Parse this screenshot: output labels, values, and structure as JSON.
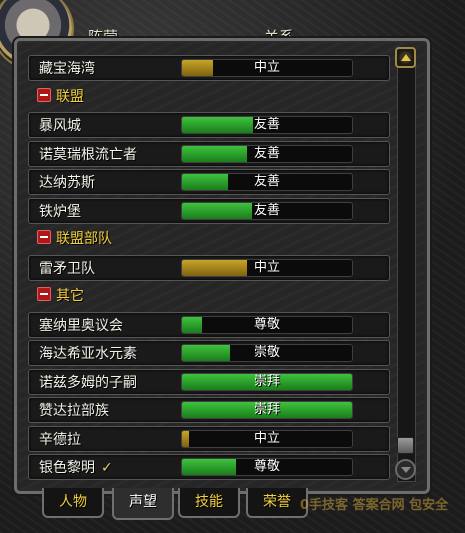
{
  "columns": {
    "faction": "阵营",
    "standing": "关系"
  },
  "rows": [
    {
      "type": "faction",
      "name": "藏宝海湾",
      "standing": "中立",
      "progress": 0.18,
      "color": "#c9a428"
    },
    {
      "type": "header",
      "name": "联盟"
    },
    {
      "type": "faction",
      "name": "暴风城",
      "standing": "友善",
      "progress": 0.42,
      "color": "#2ea82e"
    },
    {
      "type": "faction",
      "name": "诺莫瑞根流亡者",
      "standing": "友善",
      "progress": 0.38,
      "color": "#2ea82e"
    },
    {
      "type": "faction",
      "name": "达纳苏斯",
      "standing": "友善",
      "progress": 0.27,
      "color": "#2ea82e"
    },
    {
      "type": "faction",
      "name": "铁炉堡",
      "standing": "友善",
      "progress": 0.41,
      "color": "#2ea82e"
    },
    {
      "type": "header",
      "name": "联盟部队"
    },
    {
      "type": "faction",
      "name": "雷矛卫队",
      "standing": "中立",
      "progress": 0.38,
      "color": "#c9a428"
    },
    {
      "type": "header",
      "name": "其它"
    },
    {
      "type": "faction",
      "name": "塞纳里奥议会",
      "standing": "尊敬",
      "progress": 0.12,
      "color": "#2ea82e"
    },
    {
      "type": "faction",
      "name": "海达希亚水元素",
      "standing": "崇敬",
      "progress": 0.28,
      "color": "#2ea82e"
    },
    {
      "type": "faction",
      "name": "诺兹多姆的子嗣",
      "standing": "崇拜",
      "progress": 1.0,
      "color": "#2ea82e"
    },
    {
      "type": "faction",
      "name": "赞达拉部族",
      "standing": "崇拜",
      "progress": 1.0,
      "color": "#2ea82e"
    },
    {
      "type": "faction",
      "name": "辛德拉",
      "standing": "中立",
      "progress": 0.04,
      "color": "#c9a428"
    },
    {
      "type": "faction",
      "name": "银色黎明",
      "standing": "尊敬",
      "progress": 0.32,
      "color": "#2ea82e",
      "watched": true,
      "check": "✓"
    }
  ],
  "tabs": [
    {
      "label": "人物",
      "active": false
    },
    {
      "label": "声望",
      "active": true
    },
    {
      "label": "技能",
      "active": false
    },
    {
      "label": "荣誉",
      "active": false
    }
  ],
  "watermark": "0手技客 答案合网 包安全"
}
